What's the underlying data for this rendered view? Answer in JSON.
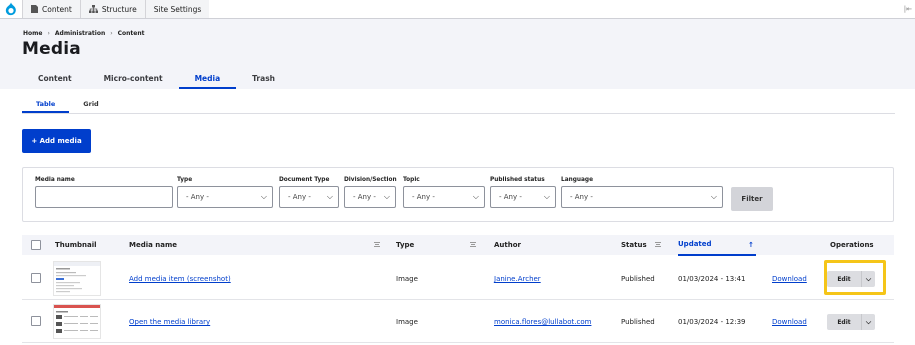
{
  "toolbar": {
    "content": "Content",
    "structure": "Structure",
    "site_settings": "Site Settings",
    "right_icon": "|⇤"
  },
  "breadcrumb": [
    "Home",
    "Administration",
    "Content"
  ],
  "breadcrumb_sep": "›",
  "page_title": "Media",
  "tabs": [
    "Content",
    "Micro-content",
    "Media",
    "Trash"
  ],
  "subtabs": [
    "Table",
    "Grid"
  ],
  "add_button": "+ Add media",
  "filters": {
    "media_name_label": "Media name",
    "type_label": "Type",
    "type_value": "- Any -",
    "doctype_label": "Document Type",
    "doctype_value": "- Any -",
    "division_label": "Division/Section",
    "division_value": "- Any -",
    "topic_label": "Topic",
    "topic_value": "- Any -",
    "published_label": "Published status",
    "published_value": "- Any -",
    "language_label": "Language",
    "language_value": "- Any -",
    "filter_button": "Filter"
  },
  "table": {
    "headers": {
      "thumbnail": "Thumbnail",
      "media_name": "Media name",
      "type": "Type",
      "author": "Author",
      "status": "Status",
      "updated": "Updated",
      "updated_arrow": "↑",
      "operations": "Operations"
    },
    "rows": [
      {
        "name": "Add media item (screenshot)",
        "type": "Image",
        "author": "Janine.Archer",
        "status": "Published",
        "updated": "01/03/2024 - 13:41",
        "download": "Download",
        "edit": "Edit"
      },
      {
        "name": "Open the media library",
        "type": "Image",
        "author": "monica.flores@lullabot.com",
        "status": "Published",
        "updated": "01/03/2024 - 12:39",
        "download": "Download",
        "edit": "Edit"
      }
    ]
  },
  "colors": {
    "accent": "#003ecc",
    "highlight": "#f5c518",
    "header_bg": "#f3f4f9"
  }
}
